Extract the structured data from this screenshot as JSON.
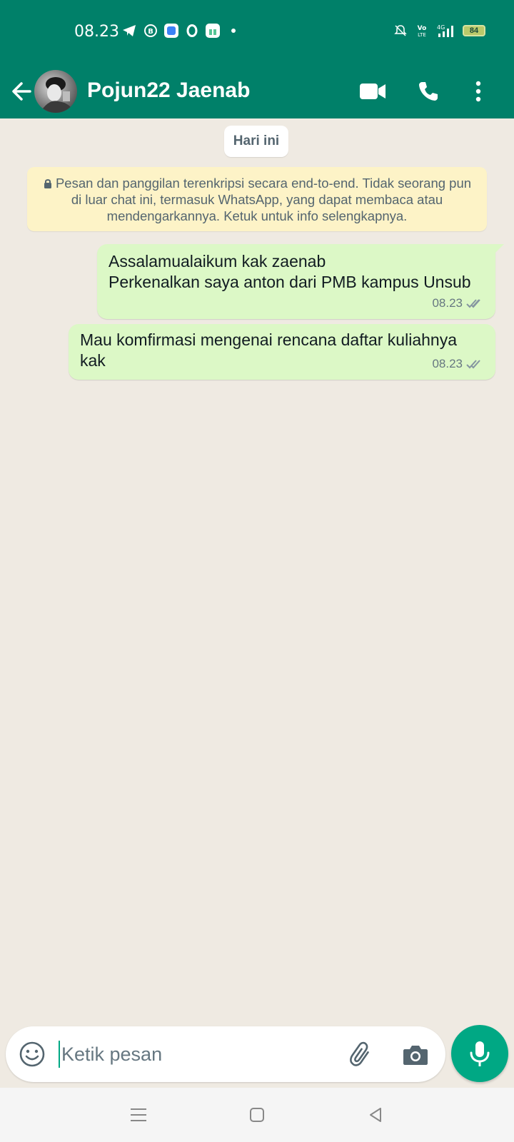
{
  "status_bar": {
    "time": "08.23",
    "battery_level": "84",
    "network": "4G"
  },
  "header": {
    "contact_name": "Pojun22 Jaenab"
  },
  "chat": {
    "date_chip": "Hari ini",
    "encryption_notice": "Pesan dan panggilan terenkripsi secara end-to-end. Tidak seorang pun di luar chat ini, termasuk WhatsApp, yang dapat membaca atau mendengarkannya. Ketuk untuk info selengkapnya.",
    "messages": [
      {
        "line1": "Assalamualaikum kak zaenab",
        "line2": "Perkenalkan saya anton dari PMB kampus Unsub",
        "time": "08.23"
      },
      {
        "line1": "Mau komfirmasi mengenai rencana daftar kuliahnya",
        "line2": "kak",
        "time": "08.23"
      }
    ]
  },
  "composer": {
    "placeholder": "Ketik pesan"
  },
  "colors": {
    "header": "#008069",
    "outgoing_bubble": "#dcf8c6",
    "chat_background": "#efeae2",
    "accent": "#00a884"
  },
  "icons": {
    "back": "arrow-left-icon",
    "video": "video-call-icon",
    "voice": "phone-icon",
    "menu": "more-vert-icon",
    "emoji": "emoji-icon",
    "attach": "paperclip-icon",
    "camera": "camera-icon",
    "mic": "mic-icon",
    "read": "double-check-icon"
  }
}
